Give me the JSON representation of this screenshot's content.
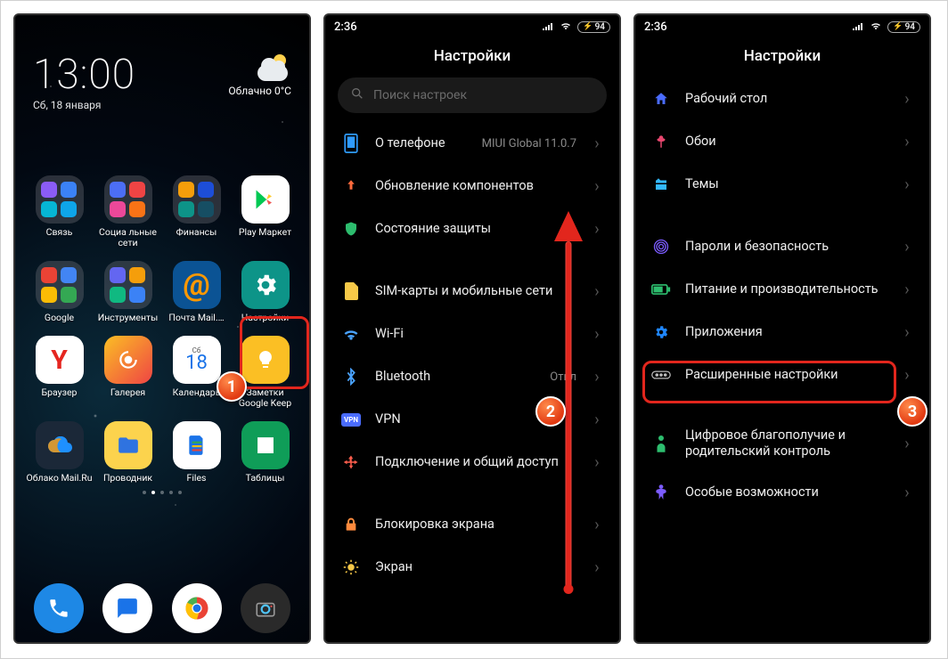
{
  "status": {
    "time_left_empty": "",
    "time2": "2:36",
    "time3": "2:36",
    "battery": "94"
  },
  "home": {
    "clock_time": "13:00",
    "clock_date": "Сб, 18 января",
    "weather_text": "Облачно  0°C",
    "apps": [
      {
        "name": "Связь"
      },
      {
        "name": "Социа льные сети"
      },
      {
        "name": "Финансы"
      },
      {
        "name": "Play Маркет"
      },
      {
        "name": "Google"
      },
      {
        "name": "Инструменты"
      },
      {
        "name": "Почта Mail.…"
      },
      {
        "name": "Настройки"
      },
      {
        "name": "Браузер"
      },
      {
        "name": "Галерея"
      },
      {
        "name": "Календарь"
      },
      {
        "name": "Заметки Google Keep"
      },
      {
        "name": "Облако Mail.Ru"
      },
      {
        "name": "Проводник"
      },
      {
        "name": "Files"
      },
      {
        "name": "Таблицы"
      }
    ],
    "calendar_day": "18",
    "calendar_dayname": "Сб"
  },
  "settings1": {
    "title": "Настройки",
    "search_placeholder": "Поиск настроек",
    "rows": [
      {
        "id": "about",
        "label": "О телефоне",
        "value": "MIUI Global 11.0.7"
      },
      {
        "id": "updates",
        "label": "Обновление компонентов"
      },
      {
        "id": "security",
        "label": "Состояние защиты"
      }
    ],
    "rows2": [
      {
        "id": "sim",
        "label": "SIM-карты и мобильные сети"
      },
      {
        "id": "wifi",
        "label": "Wi-Fi",
        "value": ""
      },
      {
        "id": "bt",
        "label": "Bluetooth",
        "value": "Откл"
      },
      {
        "id": "vpn",
        "label": "VPN"
      },
      {
        "id": "share",
        "label": "Подключение и общий доступ"
      }
    ],
    "rows3": [
      {
        "id": "lock",
        "label": "Блокировка экрана"
      },
      {
        "id": "display",
        "label": "Экран"
      }
    ]
  },
  "settings2": {
    "title": "Настройки",
    "rows": [
      {
        "id": "home",
        "label": "Рабочий стол"
      },
      {
        "id": "wall",
        "label": "Обои"
      },
      {
        "id": "themes",
        "label": "Темы"
      }
    ],
    "rows2": [
      {
        "id": "passwords",
        "label": "Пароли и безопасность"
      },
      {
        "id": "battery",
        "label": "Питание и производительность"
      },
      {
        "id": "apps",
        "label": "Приложения"
      },
      {
        "id": "advanced",
        "label": "Расширенные настройки"
      }
    ],
    "rows3": [
      {
        "id": "wellbeing",
        "label": "Цифровое благополучие и родительский контроль"
      },
      {
        "id": "a11y",
        "label": "Особые возможности"
      }
    ]
  },
  "steps": {
    "s1": "1",
    "s2": "2",
    "s3": "3"
  }
}
